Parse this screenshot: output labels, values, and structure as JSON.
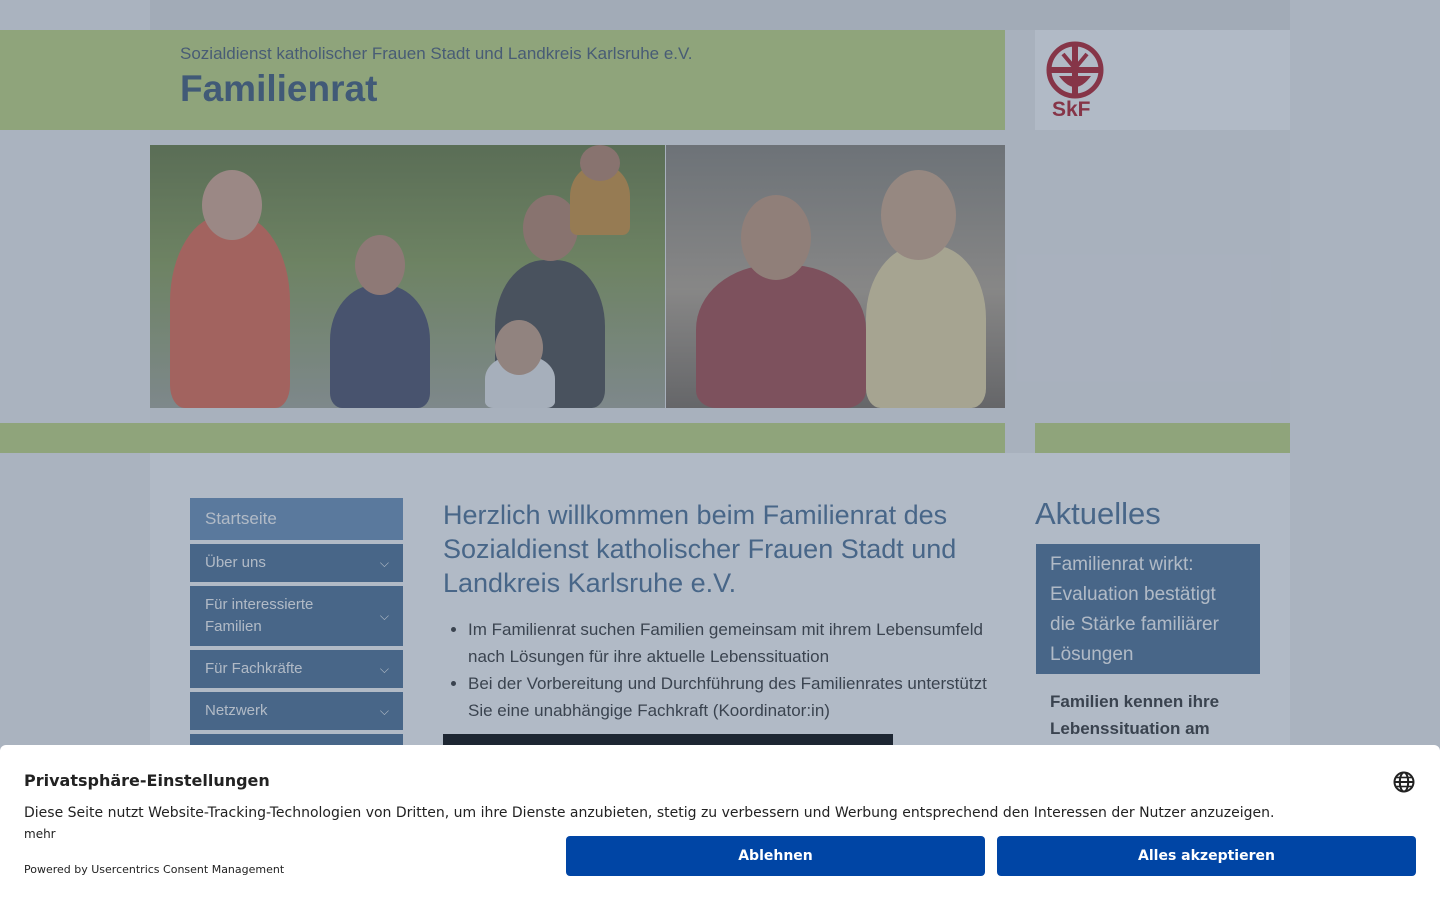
{
  "header": {
    "organization": "Sozialdienst katholischer Frauen Stadt und Landkreis Karlsruhe e.V.",
    "site_title": "Familienrat",
    "logo_text": "SkF"
  },
  "nav": {
    "items": [
      {
        "label": "Startseite",
        "active": true,
        "has_submenu": false
      },
      {
        "label": "Über uns",
        "active": false,
        "has_submenu": true
      },
      {
        "label": "Für interessierte Familien",
        "active": false,
        "has_submenu": true
      },
      {
        "label": "Für Fachkräfte",
        "active": false,
        "has_submenu": true
      },
      {
        "label": "Netzwerk",
        "active": false,
        "has_submenu": true
      }
    ]
  },
  "main": {
    "heading": "Herzlich willkommen beim Familienrat des Sozialdienst katholischer Frauen Stadt und Landkreis Karlsruhe e.V.",
    "bullets": [
      "Im Familienrat suchen Familien gemeinsam mit ihrem Lebensumfeld nach Lösungen für ihre aktuelle Lebenssituation",
      "Bei der Vorbereitung und Durchführung des Familienrates unterstützt Sie eine unabhängige Fachkraft (Koordinator:in)"
    ]
  },
  "sidebar": {
    "title": "Aktuelles",
    "news_title": "Familienrat wirkt: Evaluation bestätigt die Stärke familiärer Lösungen",
    "news_teaser": "Familien kennen ihre Lebenssituation am"
  },
  "consent": {
    "title": "Privatsphäre-Einstellungen",
    "text": "Diese Seite nutzt Website-Tracking-Technologien von Dritten, um ihre Dienste anzubieten, stetig zu verbessern und Werbung entsprechend den Interessen der Nutzer anzuzeigen.",
    "more_link": "mehr",
    "powered_by": "Powered by Usercentrics Consent Management",
    "deny_label": "Ablehnen",
    "accept_label": "Alles akzeptieren"
  },
  "colors": {
    "brand_green": "#c5d97e",
    "brand_blue": "#4a6f94",
    "logo_red": "#b51b26",
    "button_blue": "#0045a5"
  }
}
